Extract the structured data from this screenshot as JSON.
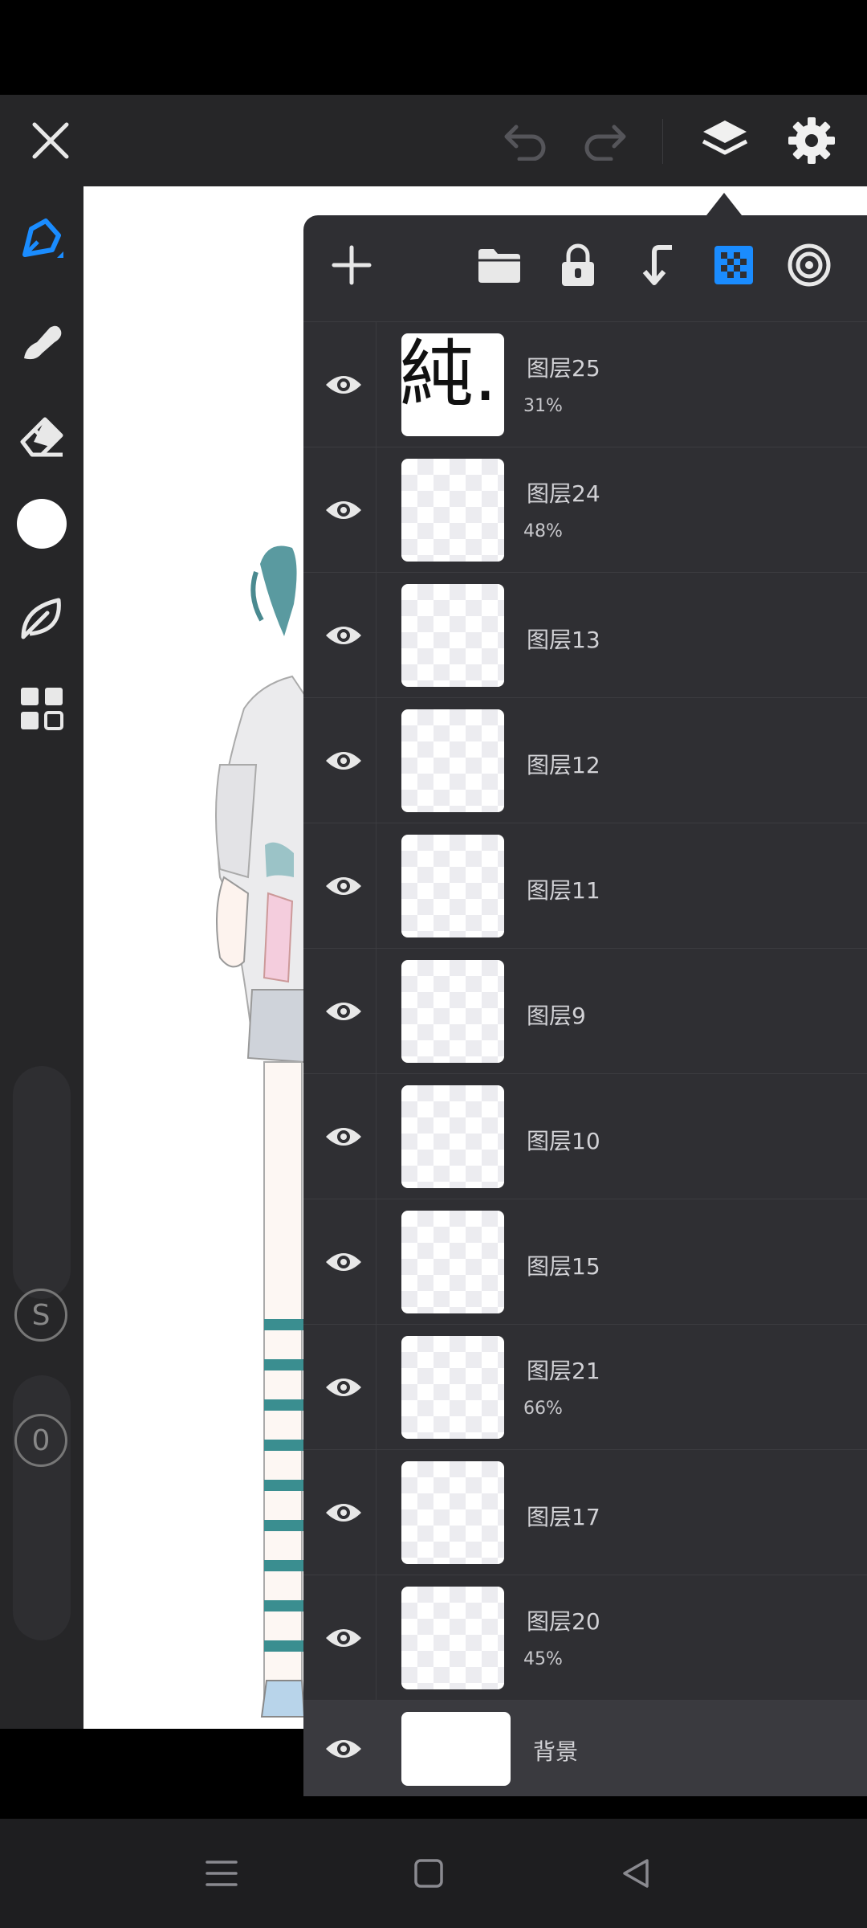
{
  "toolbar": {
    "close_icon": "close-icon",
    "undo_icon": "undo-icon",
    "redo_icon": "redo-icon",
    "layers_icon": "layers-icon",
    "settings_icon": "gear-icon"
  },
  "left_tools": [
    "pen-icon",
    "smudge-icon",
    "eraser-icon",
    "color-swatch",
    "leaf-icon",
    "grid-icon"
  ],
  "left_buttons": {
    "s_label": "S",
    "o_label": "0"
  },
  "layer_panel": {
    "actions": [
      "add-layer-icon",
      "folder-icon",
      "lock-icon",
      "merge-down-icon",
      "checker-icon",
      "target-icon"
    ],
    "accent_color": "#1a8cff",
    "layers": [
      {
        "name": "图层25",
        "opacity": "31%",
        "thumb": "text",
        "thumb_text": "純."
      },
      {
        "name": "图层24",
        "opacity": "48%"
      },
      {
        "name": "图层13",
        "opacity": ""
      },
      {
        "name": "图层12",
        "opacity": ""
      },
      {
        "name": "图层11",
        "opacity": ""
      },
      {
        "name": "图层9",
        "opacity": ""
      },
      {
        "name": "图层10",
        "opacity": ""
      },
      {
        "name": "图层15",
        "opacity": ""
      },
      {
        "name": "图层21",
        "opacity": "66%"
      },
      {
        "name": "图层17",
        "opacity": ""
      },
      {
        "name": "图层20",
        "opacity": "45%"
      }
    ],
    "background_layer": {
      "name": "背景"
    }
  },
  "navbar": [
    "menu-icon",
    "home-icon",
    "back-icon"
  ]
}
